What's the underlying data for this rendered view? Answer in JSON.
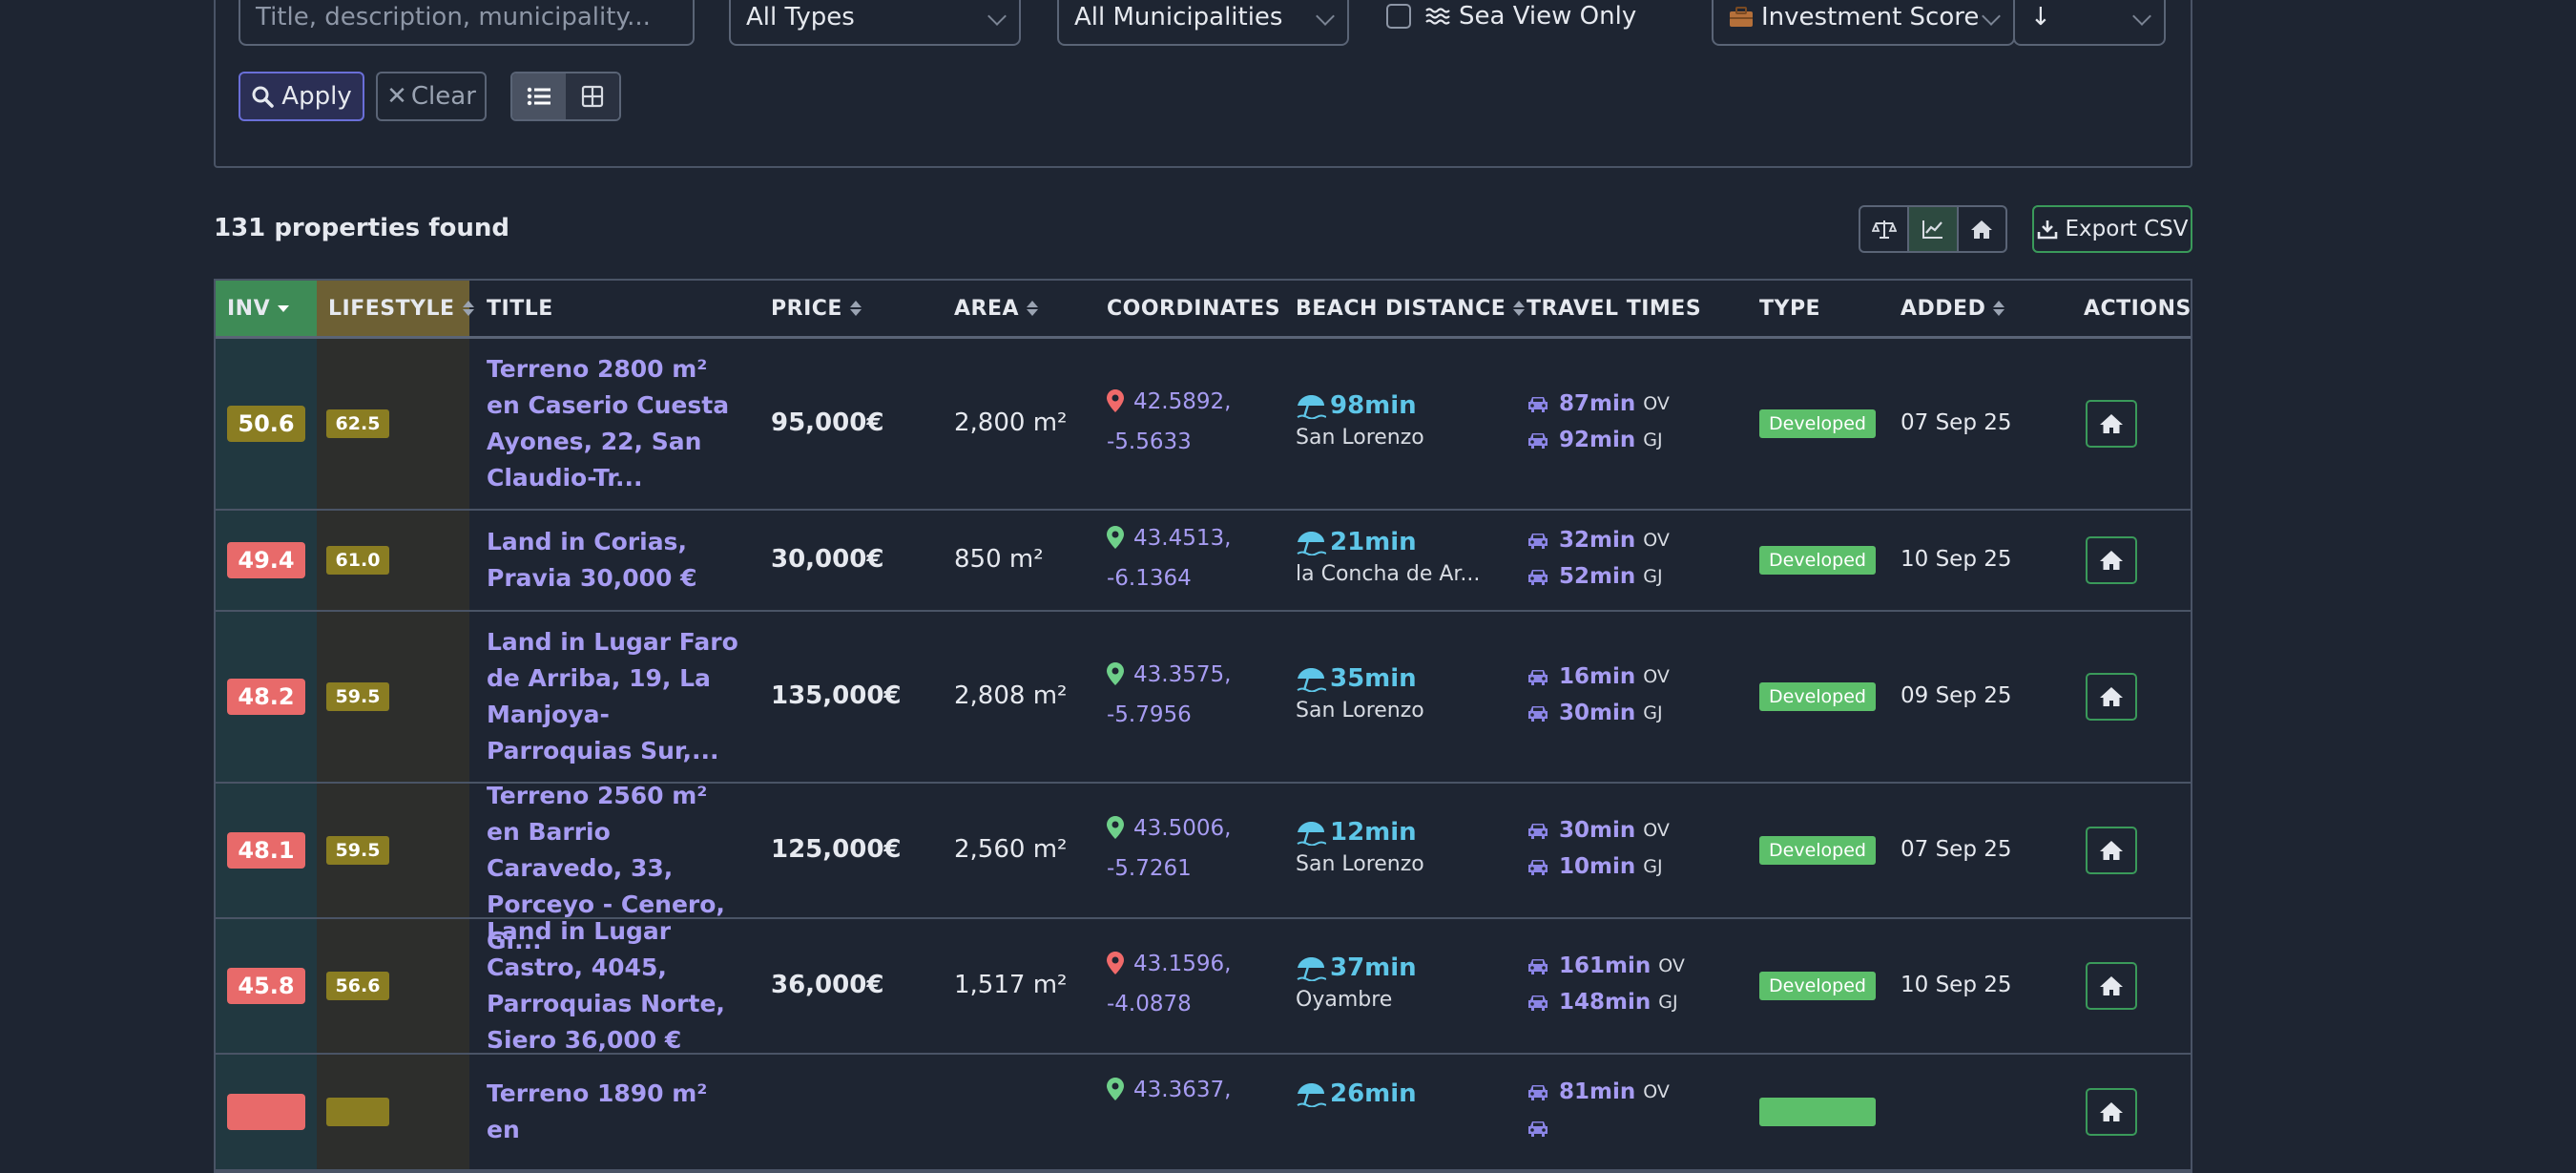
{
  "filters": {
    "search_placeholder": "Title, description, municipality...",
    "type_value": "All Types",
    "municipality_value": "All Municipalities",
    "sea_view_label": "Sea View Only",
    "sort_value": "Investment Score",
    "sort_direction": "↓",
    "apply_label": "Apply",
    "clear_label": "Clear"
  },
  "summary": {
    "count_text": "131 properties found",
    "export_label": "Export CSV"
  },
  "table": {
    "headers": {
      "inv": "INV",
      "lifestyle": "LIFESTYLE",
      "title": "TITLE",
      "price": "PRICE",
      "area": "AREA",
      "coordinates": "COORDINATES",
      "beach": "BEACH DISTANCE",
      "travel": "TRAVEL TIMES",
      "type": "TYPE",
      "added": "ADDED",
      "actions": "ACTIONS"
    },
    "rows": [
      {
        "inv": "50.6",
        "inv_color": "#8a7d22",
        "life": "62.5",
        "title": "Terreno 2800 m² en Caserio Cuesta Ayones, 22, San Claudio-Tr...",
        "price": "95,000€",
        "area": "2,800 m²",
        "lat": "42.5892,",
        "lon": "-5.5633",
        "pin_color": "#f06a6a",
        "beach_min": "98min",
        "beach_place": "San Lorenzo",
        "ov": "87min",
        "gj": "92min",
        "ov_label": "OV",
        "gj_label": "GJ",
        "type": "Developed",
        "added": "07 Sep 25"
      },
      {
        "inv": "49.4",
        "inv_color": "#e86a6a",
        "life": "61.0",
        "title": "Land in Corias, Pravia 30,000 €",
        "price": "30,000€",
        "area": "850 m²",
        "lat": "43.4513,",
        "lon": "-6.1364",
        "pin_color": "#6fd08a",
        "beach_min": "21min",
        "beach_place": "la Concha de Ar...",
        "ov": "32min",
        "gj": "52min",
        "ov_label": "OV",
        "gj_label": "GJ",
        "type": "Developed",
        "added": "10 Sep 25"
      },
      {
        "inv": "48.2",
        "inv_color": "#e86a6a",
        "life": "59.5",
        "title": "Land in Lugar Faro de Arriba, 19, La Manjoya-Parroquias Sur,...",
        "price": "135,000€",
        "area": "2,808 m²",
        "lat": "43.3575,",
        "lon": "-5.7956",
        "pin_color": "#6fd08a",
        "beach_min": "35min",
        "beach_place": "San Lorenzo",
        "ov": "16min",
        "gj": "30min",
        "ov_label": "OV",
        "gj_label": "GJ",
        "type": "Developed",
        "added": "09 Sep 25"
      },
      {
        "inv": "48.1",
        "inv_color": "#e86a6a",
        "life": "59.5",
        "title": "Terreno 2560 m² en Barrio Caravedo, 33, Porceyo - Cenero, Gi...",
        "price": "125,000€",
        "area": "2,560 m²",
        "lat": "43.5006,",
        "lon": "-5.7261",
        "pin_color": "#6fd08a",
        "beach_min": "12min",
        "beach_place": "San Lorenzo",
        "ov": "30min",
        "gj": "10min",
        "ov_label": "OV",
        "gj_label": "GJ",
        "type": "Developed",
        "added": "07 Sep 25"
      },
      {
        "inv": "45.8",
        "inv_color": "#e86a6a",
        "life": "56.6",
        "title": "Land in Lugar Castro, 4045, Parroquias Norte, Siero 36,000 €",
        "price": "36,000€",
        "area": "1,517 m²",
        "lat": "43.1596,",
        "lon": "-4.0878",
        "pin_color": "#f06a6a",
        "beach_min": "37min",
        "beach_place": "Oyambre",
        "ov": "161min",
        "gj": "148min",
        "ov_label": "OV",
        "gj_label": "GJ",
        "type": "Developed",
        "added": "10 Sep 25"
      },
      {
        "inv": "",
        "inv_color": "#e86a6a",
        "life": "",
        "title": "Terreno 1890 m² en",
        "price": "",
        "area": "",
        "lat": "43.3637,",
        "lon": "",
        "pin_color": "#6fd08a",
        "beach_min": "26min",
        "beach_place": "",
        "ov": "81min",
        "gj": "",
        "ov_label": "OV",
        "gj_label": "",
        "type": "",
        "added": ""
      }
    ]
  }
}
